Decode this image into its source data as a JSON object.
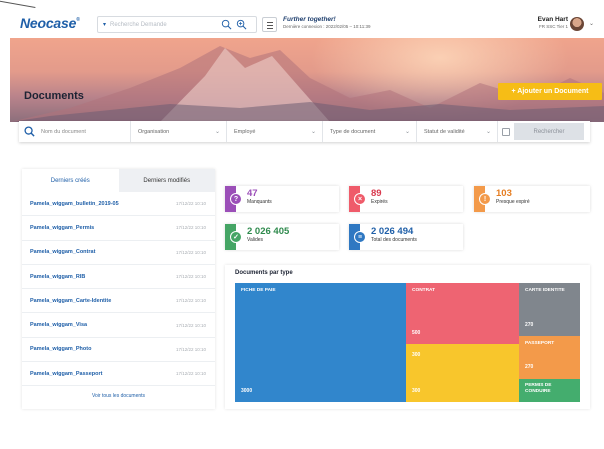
{
  "app": {
    "logo": "Neocase",
    "logo_mark": "®",
    "search_placeholder": "Recherche Demande",
    "motto": "Further together!",
    "last_login": "Dernière connexion : 2022/02/05 – 10:11:39",
    "user_name": "Evan Hart",
    "user_role": "FR SSC Tier 1"
  },
  "hero": {
    "title": "Documents",
    "add_button": "+ Ajouter un Document"
  },
  "filters": {
    "search_placeholder": "Nom du document",
    "organisation": "Organisation",
    "employee": "Employé",
    "doc_type": "Type de document",
    "validity": "Statut de validité",
    "search_button": "Rechercher"
  },
  "recent": {
    "tab_created": "Derniers créés",
    "tab_modified": "Derniers modifiés",
    "rows": [
      {
        "name": "Pamela_wiggam_bulletin_2019-05",
        "date": "17/12/22 10:10"
      },
      {
        "name": "Pamela_wiggam_Permis",
        "date": "17/12/22 10:10"
      },
      {
        "name": "Pamela_wiggam_Contrat",
        "date": "17/12/22 10:10"
      },
      {
        "name": "Pamela_wiggam_RIB",
        "date": "17/12/22 10:10"
      },
      {
        "name": "Pamela_wiggam_Carte-Identite",
        "date": "17/12/22 10:10"
      },
      {
        "name": "Pamela_wiggam_Visa",
        "date": "17/12/22 10:10"
      },
      {
        "name": "Pamela_wiggam_Photo",
        "date": "17/12/22 10:10"
      },
      {
        "name": "Pamela_wiggam_Passeport",
        "date": "17/12/22 10:10"
      }
    ],
    "see_all": "Voir tous les documents"
  },
  "stats": {
    "missing": {
      "value": "47",
      "label": "Manquants",
      "color": "#9b4fb8"
    },
    "expired": {
      "value": "89",
      "label": "Expirés",
      "color": "#ef5b6a"
    },
    "soon": {
      "value": "103",
      "label": "Presque expiré",
      "color": "#f39a4a"
    },
    "valid": {
      "value": "2 026 405",
      "label": "Valides",
      "color": "#45a565"
    },
    "total": {
      "value": "2 026 494",
      "label": "Total des documents",
      "color": "#2f78c2"
    }
  },
  "treemap": {
    "title": "Documents par type",
    "cells": [
      {
        "label": "FICHE DE PAIE",
        "value": "3000",
        "color": "#3186cc"
      },
      {
        "label": "CONTRAT",
        "value": "500",
        "color": "#ee6472"
      },
      {
        "label": "",
        "value": "300",
        "color": "#f8c62c"
      },
      {
        "label": "",
        "value": "300",
        "color": "#f8c62c"
      },
      {
        "label": "CARTE IDENTITE",
        "value": "270",
        "color": "#80868d"
      },
      {
        "label": "PASSEPORT",
        "value": "270",
        "color": "#f39a4a"
      },
      {
        "label": "PERMIS DE CONDUIRE",
        "value": "",
        "color": "#44ad6e"
      }
    ]
  }
}
